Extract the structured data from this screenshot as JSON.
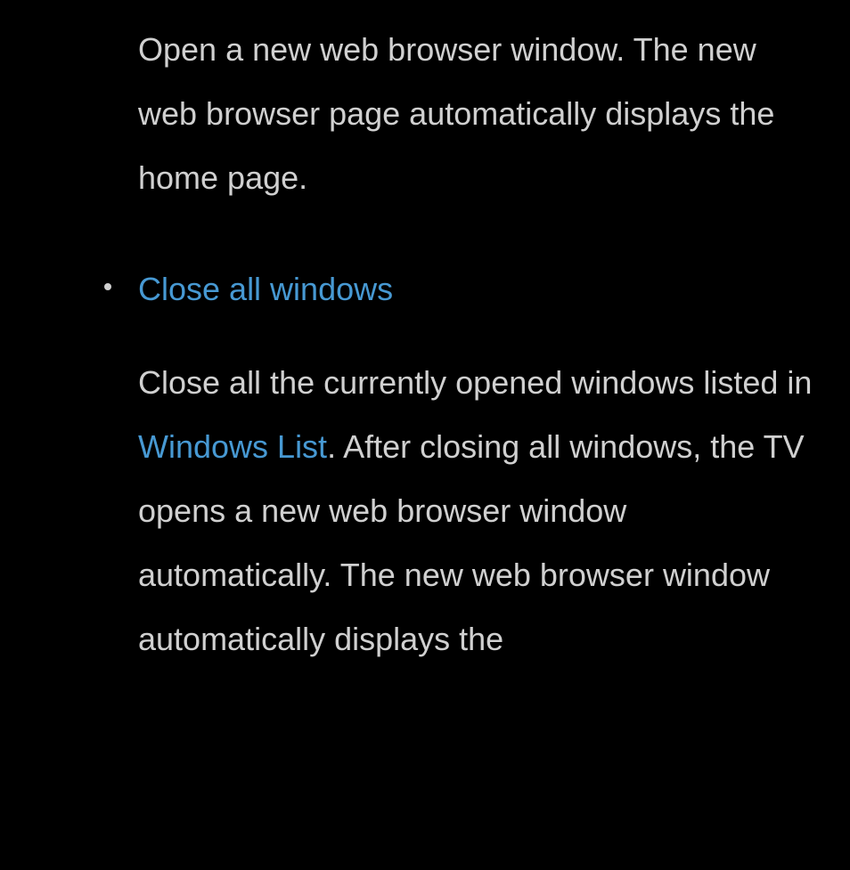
{
  "section1": {
    "description": "Open a new web browser window. The new web browser page automatically displays the home page."
  },
  "section2": {
    "heading": "Close all windows",
    "description_part1": "Close all the currently opened windows listed in ",
    "inline_link": "Windows List",
    "description_part2": ". After closing all windows, the TV opens a new web browser window automatically. The new web browser window automatically displays the"
  }
}
